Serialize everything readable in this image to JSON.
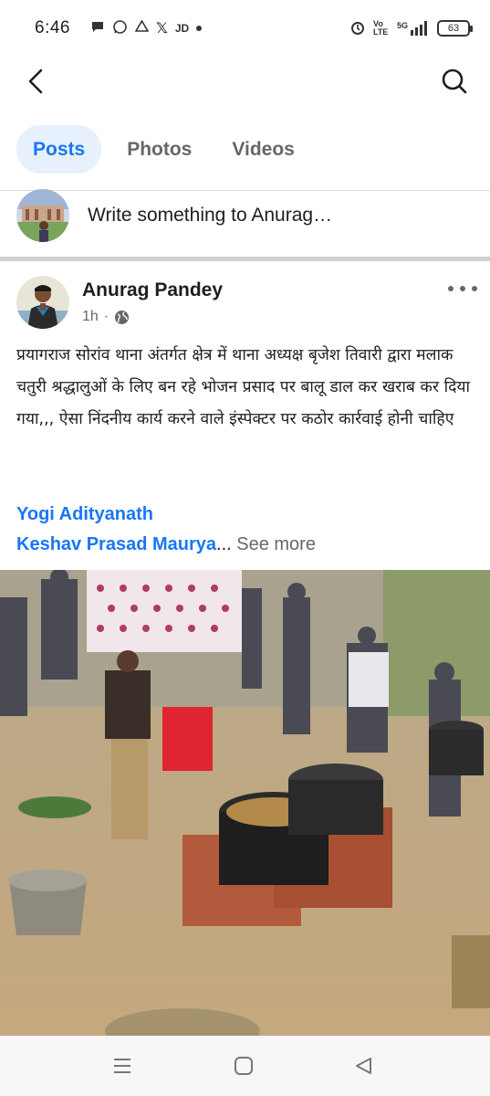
{
  "status_bar": {
    "time": "6:46",
    "notification_icons": [
      "chat-bubble-icon",
      "whatsapp-icon",
      "drive-icon",
      "x-icon",
      "jd-icon",
      "dot-icon"
    ],
    "notif_text_x": "𝕏",
    "notif_text_jd": "JD",
    "network_label": "5G",
    "volte_label": "Vo LTE",
    "battery": "63"
  },
  "header": {
    "back_icon": "back-arrow-icon",
    "search_icon": "search-icon"
  },
  "tabs": [
    {
      "label": "Posts",
      "active": true
    },
    {
      "label": "Photos",
      "active": false
    },
    {
      "label": "Videos",
      "active": false
    }
  ],
  "composer": {
    "placeholder": "Write something to Anurag…"
  },
  "post": {
    "author": "Anurag Pandey",
    "time": "1h",
    "separator": "·",
    "privacy_icon": "globe-icon",
    "text": "प्रयागराज सोरांव थाना अंतर्गत क्षेत्र में थाना अध्यक्ष बृजेश तिवारी द्वारा मलाक चतुरी श्रद्धालुओं  के लिए बन रहे भोजन प्रसाद पर बालू डाल कर खराब कर दिया गया,,, ऐसा निंदनीय कार्य करने वाले इंस्पेक्टर पर कठोर कार्रवाई होनी चाहिए",
    "mention_1": "Yogi Adityanath",
    "mention_2": "Keshav Prasad Maurya",
    "ellipsis": "...",
    "see_more": " See more"
  },
  "nav_bar": {
    "icons": [
      "recent-apps-icon",
      "home-icon",
      "back-icon"
    ]
  },
  "colors": {
    "accent": "#1877f2",
    "tab_active_bg": "#e7f0fd",
    "secondary_text": "#65676b"
  }
}
